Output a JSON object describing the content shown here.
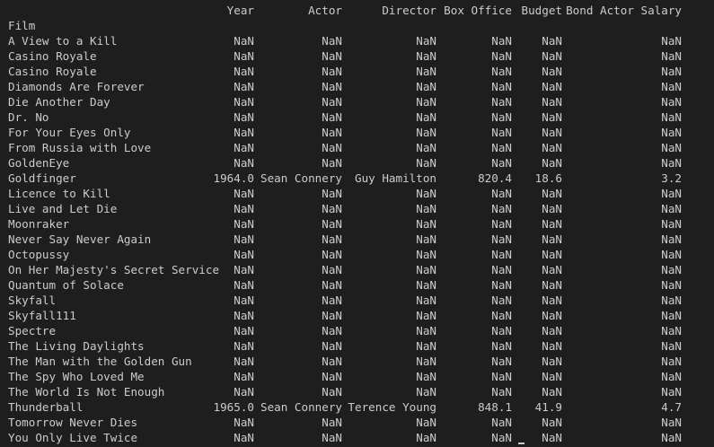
{
  "columns": {
    "year": "Year",
    "actor": "Actor",
    "director": "Director",
    "box_office": "Box Office",
    "budget": "Budget",
    "salary": "Bond Actor Salary"
  },
  "index_name": "Film",
  "rows": [
    {
      "film": "A View to a Kill",
      "year": "NaN",
      "actor": "NaN",
      "director": "NaN",
      "box_office": "NaN",
      "budget": "NaN",
      "salary": "NaN"
    },
    {
      "film": "Casino Royale",
      "year": "NaN",
      "actor": "NaN",
      "director": "NaN",
      "box_office": "NaN",
      "budget": "NaN",
      "salary": "NaN"
    },
    {
      "film": "Casino Royale",
      "year": "NaN",
      "actor": "NaN",
      "director": "NaN",
      "box_office": "NaN",
      "budget": "NaN",
      "salary": "NaN"
    },
    {
      "film": "Diamonds Are Forever",
      "year": "NaN",
      "actor": "NaN",
      "director": "NaN",
      "box_office": "NaN",
      "budget": "NaN",
      "salary": "NaN"
    },
    {
      "film": "Die Another Day",
      "year": "NaN",
      "actor": "NaN",
      "director": "NaN",
      "box_office": "NaN",
      "budget": "NaN",
      "salary": "NaN"
    },
    {
      "film": "Dr. No",
      "year": "NaN",
      "actor": "NaN",
      "director": "NaN",
      "box_office": "NaN",
      "budget": "NaN",
      "salary": "NaN"
    },
    {
      "film": "For Your Eyes Only",
      "year": "NaN",
      "actor": "NaN",
      "director": "NaN",
      "box_office": "NaN",
      "budget": "NaN",
      "salary": "NaN"
    },
    {
      "film": "From Russia with Love",
      "year": "NaN",
      "actor": "NaN",
      "director": "NaN",
      "box_office": "NaN",
      "budget": "NaN",
      "salary": "NaN"
    },
    {
      "film": "GoldenEye",
      "year": "NaN",
      "actor": "NaN",
      "director": "NaN",
      "box_office": "NaN",
      "budget": "NaN",
      "salary": "NaN"
    },
    {
      "film": "Goldfinger",
      "year": "1964.0",
      "actor": "Sean Connery",
      "director": "Guy Hamilton",
      "box_office": "820.4",
      "budget": "18.6",
      "salary": "3.2"
    },
    {
      "film": "Licence to Kill",
      "year": "NaN",
      "actor": "NaN",
      "director": "NaN",
      "box_office": "NaN",
      "budget": "NaN",
      "salary": "NaN"
    },
    {
      "film": "Live and Let Die",
      "year": "NaN",
      "actor": "NaN",
      "director": "NaN",
      "box_office": "NaN",
      "budget": "NaN",
      "salary": "NaN"
    },
    {
      "film": "Moonraker",
      "year": "NaN",
      "actor": "NaN",
      "director": "NaN",
      "box_office": "NaN",
      "budget": "NaN",
      "salary": "NaN"
    },
    {
      "film": "Never Say Never Again",
      "year": "NaN",
      "actor": "NaN",
      "director": "NaN",
      "box_office": "NaN",
      "budget": "NaN",
      "salary": "NaN"
    },
    {
      "film": "Octopussy",
      "year": "NaN",
      "actor": "NaN",
      "director": "NaN",
      "box_office": "NaN",
      "budget": "NaN",
      "salary": "NaN"
    },
    {
      "film": "On Her Majesty's Secret Service",
      "year": "NaN",
      "actor": "NaN",
      "director": "NaN",
      "box_office": "NaN",
      "budget": "NaN",
      "salary": "NaN"
    },
    {
      "film": "Quantum of Solace",
      "year": "NaN",
      "actor": "NaN",
      "director": "NaN",
      "box_office": "NaN",
      "budget": "NaN",
      "salary": "NaN"
    },
    {
      "film": "Skyfall",
      "year": "NaN",
      "actor": "NaN",
      "director": "NaN",
      "box_office": "NaN",
      "budget": "NaN",
      "salary": "NaN"
    },
    {
      "film": "Skyfall111",
      "year": "NaN",
      "actor": "NaN",
      "director": "NaN",
      "box_office": "NaN",
      "budget": "NaN",
      "salary": "NaN"
    },
    {
      "film": "Spectre",
      "year": "NaN",
      "actor": "NaN",
      "director": "NaN",
      "box_office": "NaN",
      "budget": "NaN",
      "salary": "NaN"
    },
    {
      "film": "The Living Daylights",
      "year": "NaN",
      "actor": "NaN",
      "director": "NaN",
      "box_office": "NaN",
      "budget": "NaN",
      "salary": "NaN"
    },
    {
      "film": "The Man with the Golden Gun",
      "year": "NaN",
      "actor": "NaN",
      "director": "NaN",
      "box_office": "NaN",
      "budget": "NaN",
      "salary": "NaN"
    },
    {
      "film": "The Spy Who Loved Me",
      "year": "NaN",
      "actor": "NaN",
      "director": "NaN",
      "box_office": "NaN",
      "budget": "NaN",
      "salary": "NaN"
    },
    {
      "film": "The World Is Not Enough",
      "year": "NaN",
      "actor": "NaN",
      "director": "NaN",
      "box_office": "NaN",
      "budget": "NaN",
      "salary": "NaN"
    },
    {
      "film": "Thunderball",
      "year": "1965.0",
      "actor": "Sean Connery",
      "director": "Terence Young",
      "box_office": "848.1",
      "budget": "41.9",
      "salary": "4.7"
    },
    {
      "film": "Tomorrow Never Dies",
      "year": "NaN",
      "actor": "NaN",
      "director": "NaN",
      "box_office": "NaN",
      "budget": "NaN",
      "salary": "NaN"
    },
    {
      "film": "You Only Live Twice",
      "year": "NaN",
      "actor": "NaN",
      "director": "NaN",
      "box_office": "NaN",
      "budget": "NaN",
      "salary": "NaN"
    }
  ],
  "colors": {
    "background": "#1e1e1e",
    "text": "#cccccc"
  }
}
